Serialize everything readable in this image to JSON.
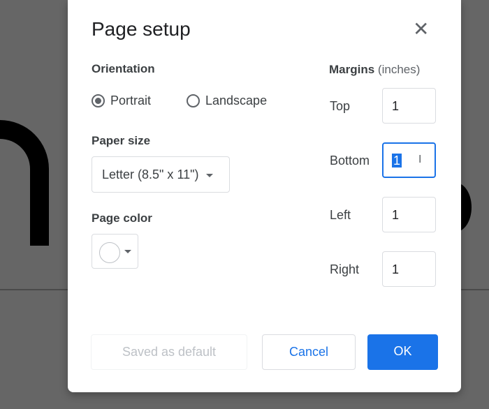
{
  "dialog": {
    "title": "Page setup"
  },
  "orientation": {
    "label": "Orientation",
    "options": [
      {
        "label": "Portrait",
        "selected": true
      },
      {
        "label": "Landscape",
        "selected": false
      }
    ]
  },
  "paper_size": {
    "label": "Paper size",
    "value": "Letter (8.5\" x 11\")"
  },
  "page_color": {
    "label": "Page color",
    "value": "#ffffff"
  },
  "margins": {
    "label": "Margins",
    "unit": "(inches)",
    "top_label": "Top",
    "top": "1",
    "bottom_label": "Bottom",
    "bottom": "1",
    "left_label": "Left",
    "left": "1",
    "right_label": "Right",
    "right": "1"
  },
  "buttons": {
    "default": "Saved as default",
    "cancel": "Cancel",
    "ok": "OK"
  },
  "colors": {
    "accent": "#1a73e8"
  }
}
